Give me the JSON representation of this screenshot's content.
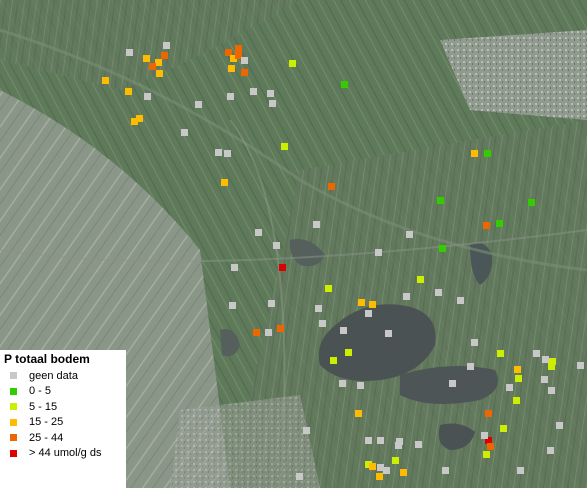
{
  "legend": {
    "title": "P totaal bodem",
    "classes": [
      {
        "label": "geen data",
        "color": "#c8c8c8"
      },
      {
        "label": "0 - 5",
        "color": "#33cc00"
      },
      {
        "label": "5 - 15",
        "color": "#ccee00"
      },
      {
        "label": "15 - 25",
        "color": "#ffbb00"
      },
      {
        "label": "25 - 44",
        "color": "#ee6600"
      },
      {
        "label": "> 44 umol/g ds",
        "color": "#dd0000"
      }
    ]
  }
}
